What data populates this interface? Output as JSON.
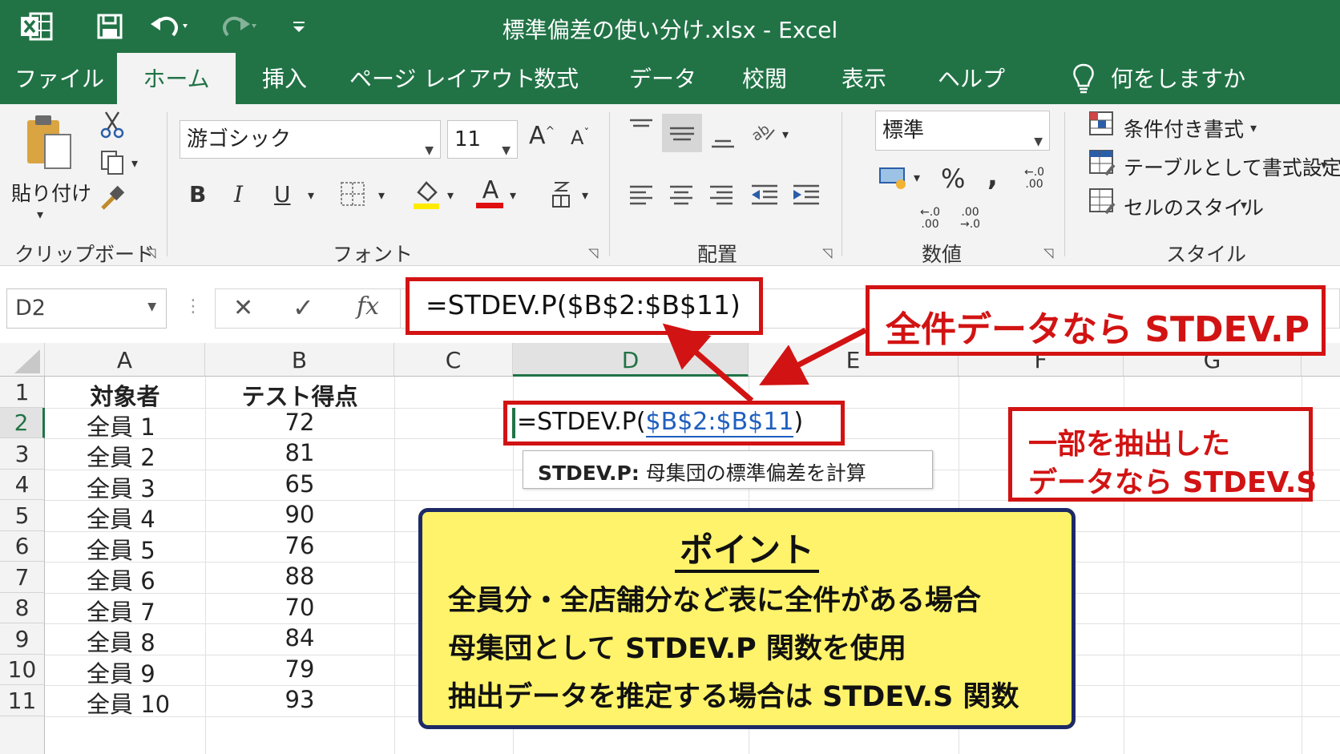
{
  "window": {
    "title": "標準偏差の使い分け.xlsx  -  Excel"
  },
  "colors": {
    "excel_green": "#217346",
    "callout_red": "#d21313",
    "point_yellow": "#fef36a",
    "point_border": "#1d2a66",
    "ref_blue": "#1f5fbf"
  },
  "quick_access": {
    "icons": [
      "excel-logo-icon",
      "save-icon",
      "undo-icon",
      "redo-icon",
      "customize-icon"
    ]
  },
  "tabs": [
    {
      "label": "ファイル",
      "active": false
    },
    {
      "label": "ホーム",
      "active": true
    },
    {
      "label": "挿入",
      "active": false
    },
    {
      "label": "ページ レイアウト",
      "active": false
    },
    {
      "label": "数式",
      "active": false
    },
    {
      "label": "データ",
      "active": false
    },
    {
      "label": "校閲",
      "active": false
    },
    {
      "label": "表示",
      "active": false
    },
    {
      "label": "ヘルプ",
      "active": false
    }
  ],
  "tell_me": "何をしますか",
  "ribbon": {
    "clipboard": {
      "label": "クリップボード",
      "paste": "貼り付け"
    },
    "font": {
      "label": "フォント",
      "font_name": "游ゴシック",
      "font_size": "11",
      "bold": "B",
      "italic": "I",
      "underline": "U",
      "grow": "A",
      "shrink": "A",
      "font_color": "A"
    },
    "alignment": {
      "label": "配置"
    },
    "number": {
      "label": "数値",
      "format": "標準",
      "percent": "%",
      "comma": ","
    },
    "styles": {
      "label": "スタイル",
      "conditional": "条件付き書式",
      "table": "テーブルとして書式設定",
      "cell_styles": "セルのスタイル"
    }
  },
  "formula_bar": {
    "name_box": "D2",
    "cancel": "✕",
    "enter": "✓",
    "fx": "fx",
    "formula": "=STDEV.P($B$2:$B$11)"
  },
  "sheet": {
    "columns": [
      "A",
      "B",
      "C",
      "D",
      "E",
      "F",
      "G"
    ],
    "rows": [
      "1",
      "2",
      "3",
      "4",
      "5",
      "6",
      "7",
      "8",
      "9",
      "10",
      "11"
    ],
    "headers": [
      "対象者",
      "テスト得点"
    ],
    "data": [
      {
        "name": "全員 1",
        "score": "72"
      },
      {
        "name": "全員 2",
        "score": "81"
      },
      {
        "name": "全員 3",
        "score": "65"
      },
      {
        "name": "全員 4",
        "score": "90"
      },
      {
        "name": "全員 5",
        "score": "76"
      },
      {
        "name": "全員 6",
        "score": "88"
      },
      {
        "name": "全員 7",
        "score": "70"
      },
      {
        "name": "全員 8",
        "score": "84"
      },
      {
        "name": "全員 9",
        "score": "79"
      },
      {
        "name": "全員 10",
        "score": "93"
      }
    ],
    "edit_cell": {
      "prefix": "=STDEV.P(",
      "ref": "$B$2:$B$11",
      "suffix": ")"
    },
    "tooltip": {
      "func": "STDEV.P:",
      "desc": "母集団の標準偏差を計算"
    }
  },
  "callouts": {
    "stdev_p": "全件データなら STDEV.P",
    "stdev_s_line1": "一部を抽出した",
    "stdev_s_line2": "データなら STDEV.S"
  },
  "point": {
    "title": "ポイント",
    "line1": "全員分・全店舗分など表に全件がある場合",
    "line2": "母集団として STDEV.P 関数を使用",
    "line3": "抽出データを推定する場合は STDEV.S 関数"
  }
}
